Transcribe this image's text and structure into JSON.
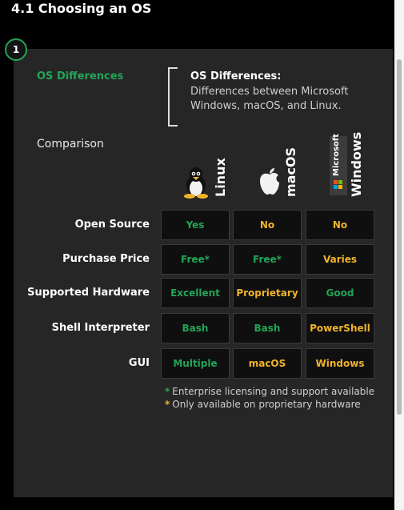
{
  "page_title": "4.1 Choosing an OS",
  "step_number": "1",
  "os_differences_label": "OS Differences",
  "definition": {
    "title": "OS Differences:",
    "body": "Differences between Microsoft Windows, macOS, and Linux."
  },
  "comparison_label": "Comparison",
  "os_columns": [
    {
      "name": "Linux",
      "icon": "tux-penguin-icon"
    },
    {
      "name": "macOS",
      "icon": "apple-icon"
    },
    {
      "name": "Windows",
      "icon": "microsoft-logo-icon",
      "brand_text": "Microsoft"
    }
  ],
  "rows": [
    {
      "label": "Open Source",
      "values": [
        {
          "text": "Yes",
          "color": "green"
        },
        {
          "text": "No",
          "color": "gold"
        },
        {
          "text": "No",
          "color": "gold"
        }
      ]
    },
    {
      "label": "Purchase Price",
      "values": [
        {
          "text": "Free*",
          "color": "green"
        },
        {
          "text": "Free*",
          "color": "green"
        },
        {
          "text": "Varies",
          "color": "gold"
        }
      ]
    },
    {
      "label": "Supported Hardware",
      "values": [
        {
          "text": "Excellent",
          "color": "green"
        },
        {
          "text": "Proprietary",
          "color": "gold"
        },
        {
          "text": "Good",
          "color": "green"
        }
      ]
    },
    {
      "label": "Shell Interpreter",
      "values": [
        {
          "text": "Bash",
          "color": "green"
        },
        {
          "text": "Bash",
          "color": "green"
        },
        {
          "text": "PowerShell",
          "color": "gold"
        }
      ]
    },
    {
      "label": "GUI",
      "values": [
        {
          "text": "Multiple",
          "color": "green"
        },
        {
          "text": "macOS",
          "color": "gold"
        },
        {
          "text": "Windows",
          "color": "gold"
        }
      ]
    }
  ],
  "notes": [
    {
      "star_color": "green",
      "text": "Enterprise licensing and support available"
    },
    {
      "star_color": "gold",
      "text": "Only available on proprietary hardware"
    }
  ],
  "colors": {
    "green": "#22a557",
    "gold": "#f0b429"
  }
}
